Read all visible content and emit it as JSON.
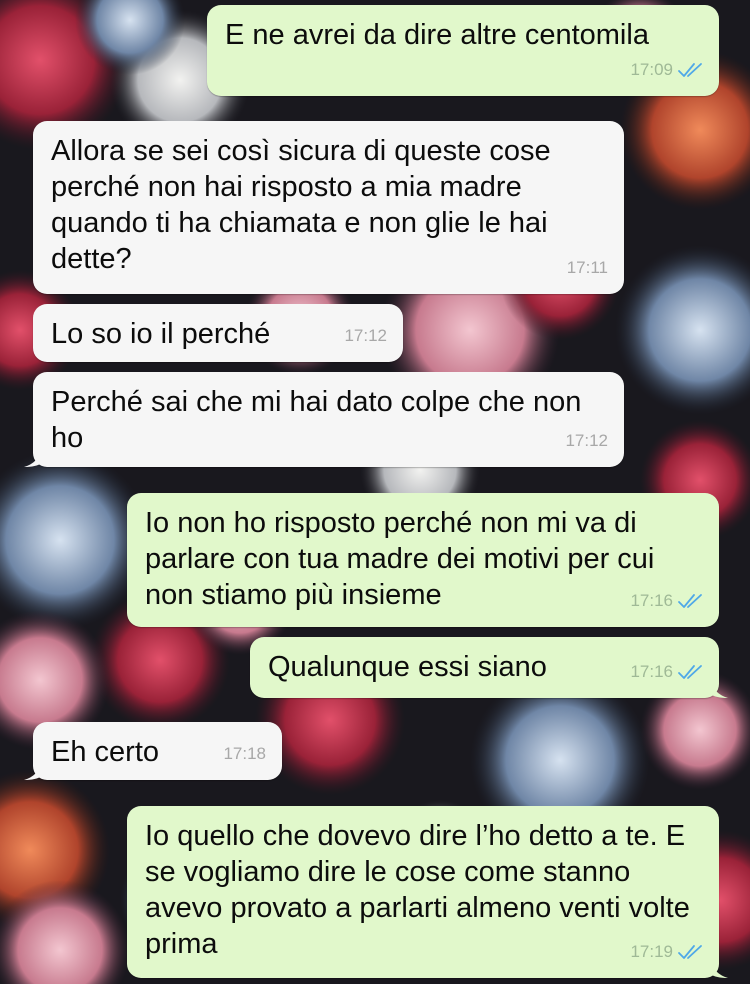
{
  "colors": {
    "outgoing_bubble": "#e1f8cb",
    "incoming_bubble": "#f6f6f6",
    "read_ticks": "#4fa8e8"
  },
  "messages": [
    {
      "direction": "out",
      "text": "E ne avrei da dire altre centomila",
      "time": "17:09",
      "status": "read-double-check-icon"
    },
    {
      "direction": "in",
      "text": "Allora se sei così sicura di queste cose perché non hai risposto a mia madre quando ti ha chiamata e non glie le hai dette?",
      "time": "17:11"
    },
    {
      "direction": "in",
      "text": "Lo so io il perché",
      "time": "17:12"
    },
    {
      "direction": "in",
      "text": "Perché sai che mi hai dato colpe che non ho",
      "time": "17:12"
    },
    {
      "direction": "out",
      "text": "Io non ho risposto perché non mi va di parlare con tua madre dei motivi per cui non stiamo più insieme",
      "time": "17:16",
      "status": "read-double-check-icon"
    },
    {
      "direction": "out",
      "text": "Qualunque essi siano",
      "time": "17:16",
      "status": "read-double-check-icon"
    },
    {
      "direction": "in",
      "text": "Eh certo",
      "time": "17:18"
    },
    {
      "direction": "out",
      "text": "Io quello che dovevo dire l’ho detto a te. E se vogliamo dire le cose come stanno avevo provato a parlarti almeno venti volte prima",
      "time": "17:19",
      "status": "read-double-check-icon"
    }
  ]
}
